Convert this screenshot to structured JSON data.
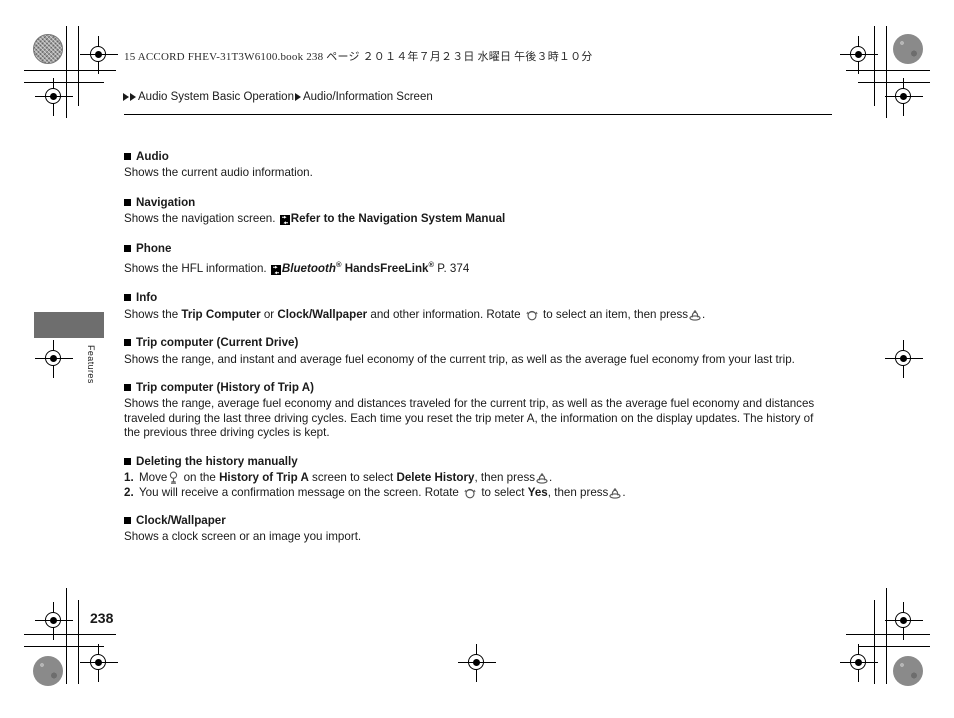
{
  "book_header": "15 ACCORD FHEV-31T3W6100.book   238 ページ   ２０１４年７月２３日   水曜日   午後３時１０分",
  "side_tab_label": "Features",
  "page_number": "238",
  "breadcrumb": {
    "segment1": "Audio System Basic Operation",
    "segment2": "Audio/Information Screen"
  },
  "sections": {
    "audio": {
      "heading": "Audio",
      "body": "Shows the current audio information."
    },
    "navigation": {
      "heading": "Navigation",
      "body_lead": "Shows the navigation screen.",
      "reference": "Refer to the Navigation System Manual"
    },
    "phone": {
      "heading": "Phone",
      "body_lead": "Shows the HFL information.",
      "ref_brand": "Bluetooth",
      "ref_sup1": "®",
      "ref_name": "HandsFreeLink",
      "ref_sup2": "®",
      "ref_page": "P. 374"
    },
    "info": {
      "heading": "Info",
      "text1": "Shows the",
      "bold1": "Trip Computer",
      "text2": "or",
      "bold2": "Clock/Wallpaper",
      "text3": "and other information. Rotate",
      "text4": "to select an item, then press",
      "text5": "."
    },
    "trip_current": {
      "heading": "Trip computer (Current Drive)",
      "body": "Shows the range, and instant and average fuel economy of the current trip, as well as the average fuel economy from your last trip."
    },
    "trip_history": {
      "heading": "Trip computer (History of Trip A)",
      "body": "Shows the range, average fuel economy and distances traveled for the current trip, as well as the average fuel economy and distances traveled during the last three driving cycles. Each time you reset the trip meter A, the information on the display updates. The history of the previous three driving cycles is kept."
    },
    "deleting": {
      "heading": "Deleting the history manually",
      "step1": {
        "number": "1.",
        "t1": "Move",
        "t2": "on the",
        "b1": "History of Trip A",
        "t3": "screen to select",
        "b2": "Delete History",
        "t4": ", then press",
        "t5": "."
      },
      "step2": {
        "number": "2.",
        "t1": "You will receive a confirmation message on the screen. Rotate",
        "t2": "to select",
        "b1": "Yes",
        "t3": ",",
        "t4": "then press",
        "t5": "."
      }
    },
    "clock": {
      "heading": "Clock/Wallpaper",
      "body": "Shows a clock screen or an image you import."
    }
  },
  "icons": {
    "jump": "jump-reference-icon",
    "rotate_knob": "rotate-knob-icon",
    "press_knob": "press-knob-icon",
    "move_cursor": "move-cursor-icon"
  },
  "colors": {
    "text": "#1a1a1a",
    "tab_gray": "#6e6e6e",
    "rule": "#000000"
  }
}
